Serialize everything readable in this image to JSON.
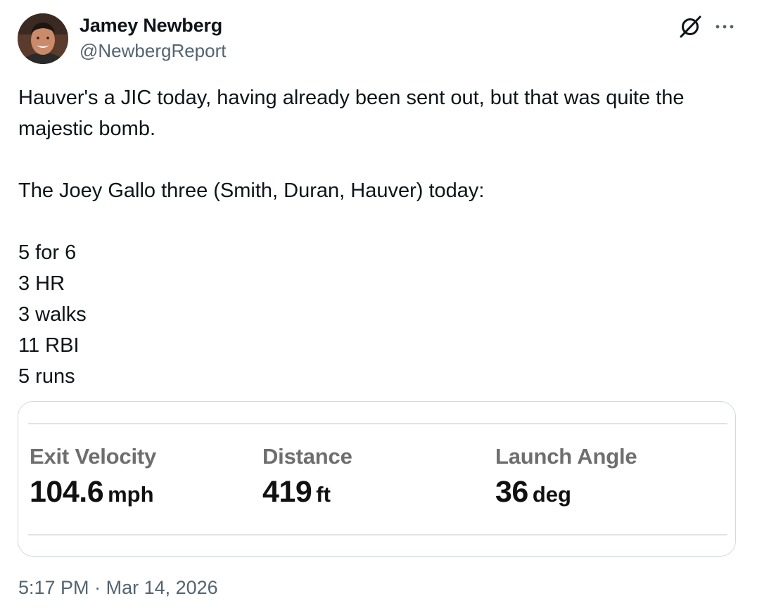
{
  "author": {
    "display_name": "Jamey Newberg",
    "handle": "@NewbergReport",
    "avatar_icon": "profile-photo"
  },
  "header_actions": {
    "grok_icon": "grok-icon",
    "more_icon": "more-dots-icon"
  },
  "tweet": {
    "lines": [
      "Hauver's a JIC today, having already been sent out, but that was quite the",
      "majestic bomb.",
      "",
      "The Joey Gallo three (Smith, Duran, Hauver) today:",
      "",
      "5 for 6",
      "3 HR",
      "3 walks",
      "11 RBI",
      "5 runs"
    ]
  },
  "card": {
    "stats": [
      {
        "label": "Exit Velocity",
        "value": "104.6",
        "unit": "mph"
      },
      {
        "label": "Distance",
        "value": "419",
        "unit": "ft"
      },
      {
        "label": "Launch Angle",
        "value": "36",
        "unit": "deg"
      }
    ],
    "rule_color": "#e3e3e3"
  },
  "meta": {
    "time": "5:17 PM",
    "separator": "·",
    "date": "Mar 14, 2026"
  },
  "colors": {
    "text_primary": "#0f1419",
    "text_secondary": "#536471",
    "stat_label": "#6e6e6e",
    "card_border": "#cfd9de"
  }
}
